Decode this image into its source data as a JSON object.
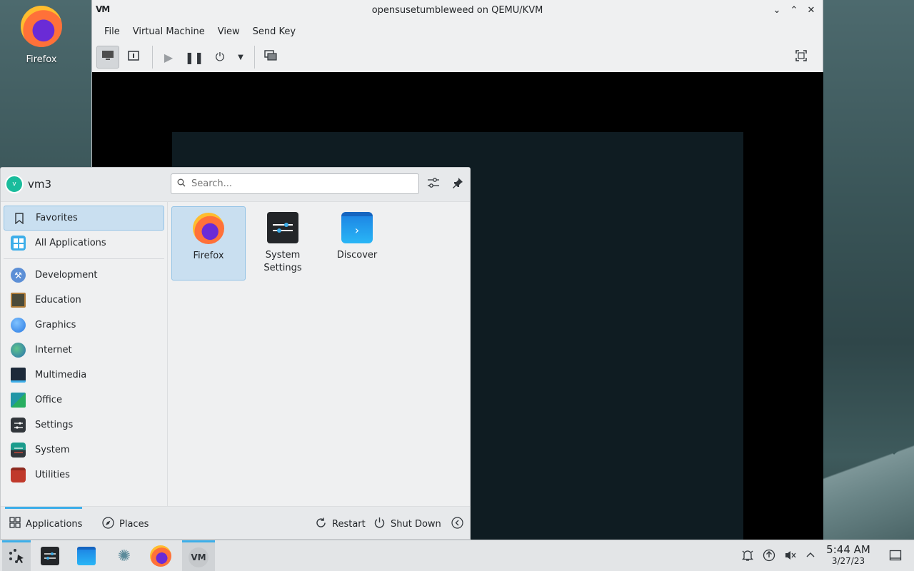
{
  "desktop": {
    "firefox_label": "Firefox"
  },
  "vm_window": {
    "app_icon_text": "VM",
    "title": "opensusetumbleweed on QEMU/KVM",
    "controls": {
      "minimize": "⌄",
      "maximize": "⌃",
      "close": "✕"
    },
    "menu": [
      "File",
      "Virtual Machine",
      "View",
      "Send Key"
    ]
  },
  "launcher": {
    "user": {
      "initial": "v",
      "name": "vm3"
    },
    "search": {
      "placeholder": "Search..."
    },
    "categories": [
      {
        "label": "Favorites",
        "icon": "bookmark-icon",
        "color": "#eff0f1"
      },
      {
        "label": "All Applications",
        "icon": "grid-icon",
        "color": "#3daee9"
      },
      {
        "label": "Development",
        "icon": "development-icon",
        "color": "#5c8fd6"
      },
      {
        "label": "Education",
        "icon": "education-icon",
        "color": "#4a4a3a"
      },
      {
        "label": "Graphics",
        "icon": "graphics-icon",
        "color": "#3d8ef0"
      },
      {
        "label": "Internet",
        "icon": "internet-icon",
        "color": "#2e9c6a"
      },
      {
        "label": "Multimedia",
        "icon": "multimedia-icon",
        "color": "#1d2a3a"
      },
      {
        "label": "Office",
        "icon": "office-icon",
        "color": "#2196a6"
      },
      {
        "label": "Settings",
        "icon": "settings-icon",
        "color": "#31363b"
      },
      {
        "label": "System",
        "icon": "system-icon",
        "color": "#1b9c8c"
      },
      {
        "label": "Utilities",
        "icon": "utilities-icon",
        "color": "#c0392b"
      }
    ],
    "favorites": [
      {
        "label": "Firefox",
        "icon": "firefox-icon"
      },
      {
        "label": "System\nSettings",
        "icon": "system-settings-icon"
      },
      {
        "label": "Discover",
        "icon": "discover-icon"
      }
    ],
    "footer": {
      "applications": "Applications",
      "places": "Places",
      "restart": "Restart",
      "shutdown": "Shut Down"
    }
  },
  "taskbar": {
    "clock": {
      "time": "5:44 AM",
      "date": "3/27/23"
    },
    "vm_task_text": "VM"
  },
  "colors": {
    "accent": "#3daee9",
    "selection": "#c9dff0"
  }
}
